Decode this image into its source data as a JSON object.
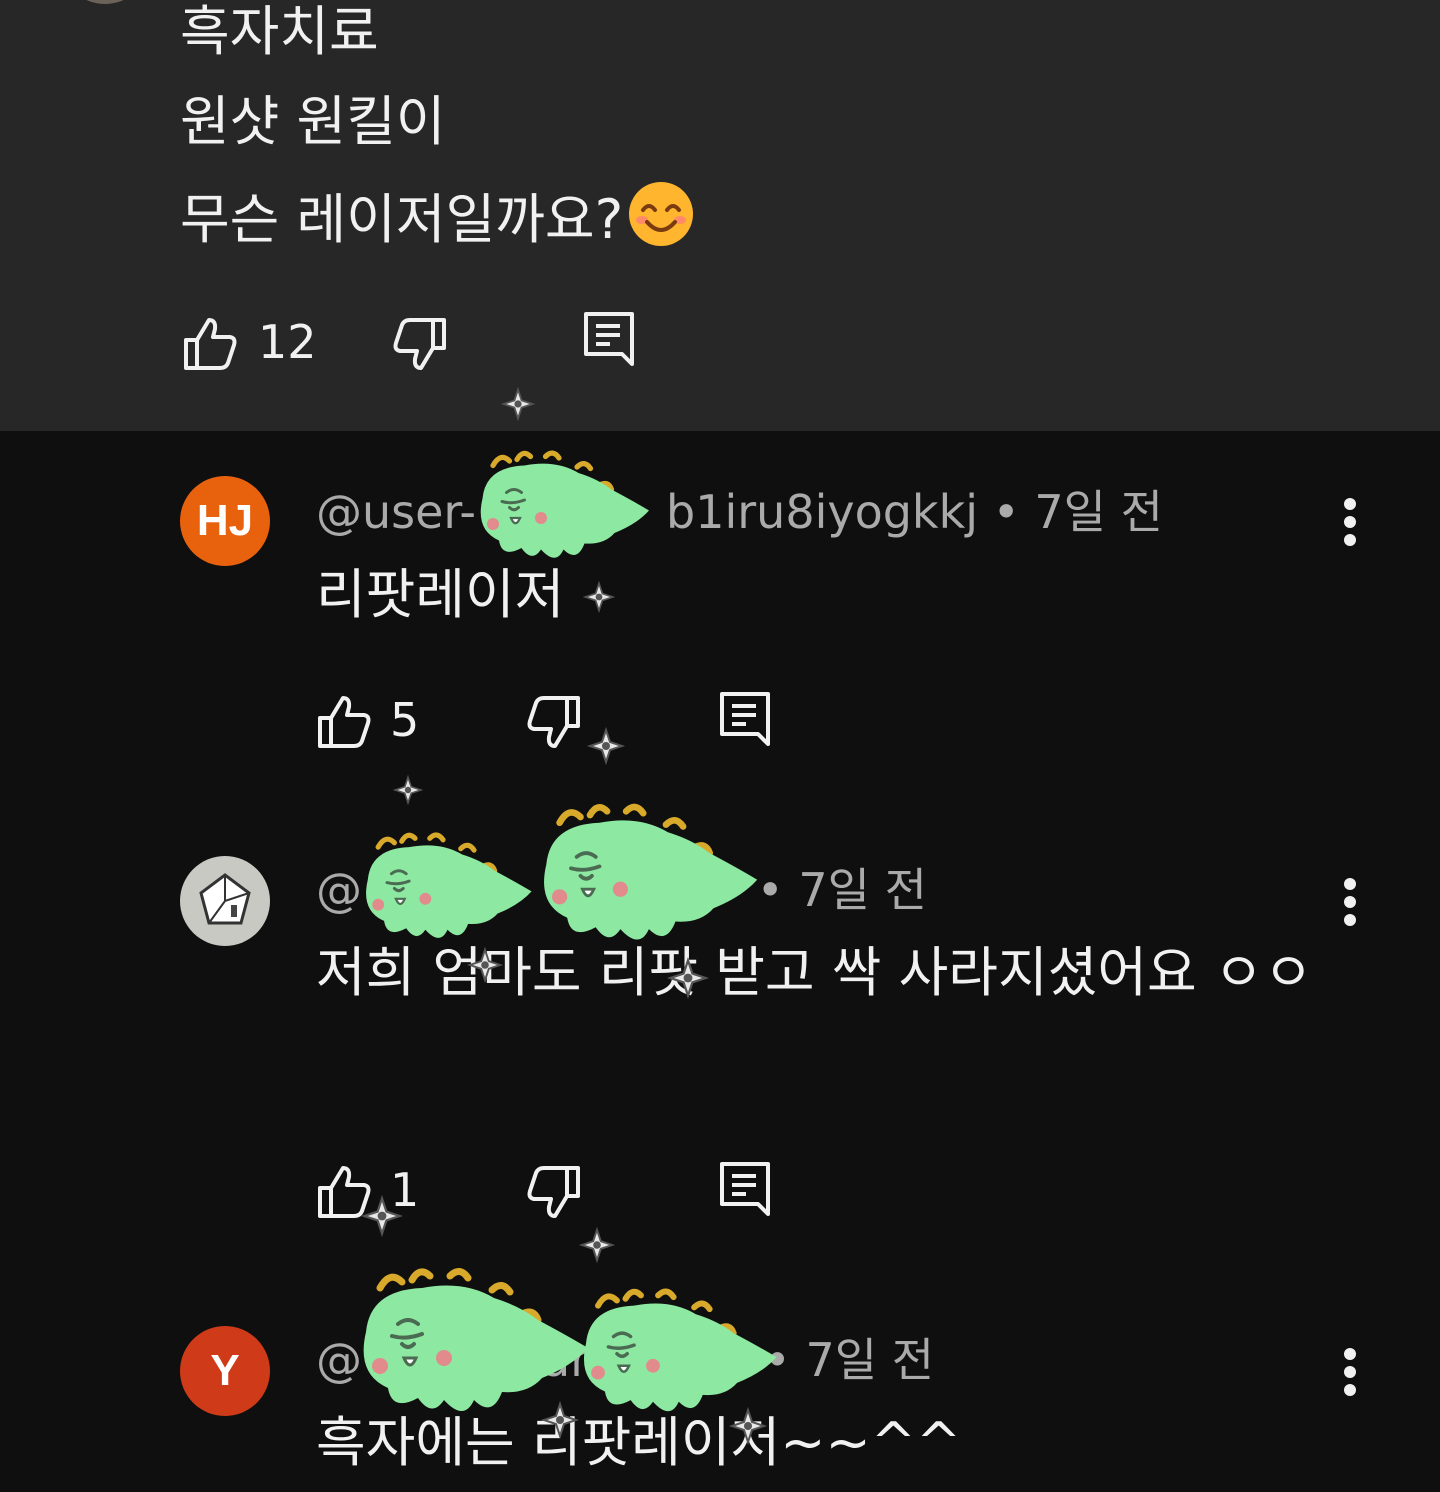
{
  "parent_comment": {
    "lines": [
      "흑자치료",
      "원샷 원킬이",
      "무슨 레이저일까요?"
    ],
    "emoji": "smiling-face-icon",
    "like_count": "12"
  },
  "replies": [
    {
      "avatar_initials": "HJ",
      "avatar_color": "#e8620e",
      "handle": "@user-",
      "handle_tail": "b1iru8iyogkkj",
      "separator": "•",
      "time": "7일 전",
      "text": "리팟레이저",
      "like_count": "5"
    },
    {
      "avatar_initials": "",
      "avatar_color": "#c9c9c4",
      "handle": "@",
      "separator": "•",
      "time": "7일 전",
      "text": "저희 엄마도 리팟 받고 싹 사라지셨어요 ㅇㅇ",
      "like_count": "1"
    },
    {
      "avatar_initials": "Y",
      "avatar_color": "#cf3a18",
      "handle": "@",
      "handle_mid": "ar",
      "separator": "•",
      "time": "7일 전",
      "text": "흑자에는 리팟레이저~~^^"
    }
  ],
  "icons": {
    "like": "thumbs-up-icon",
    "dislike": "thumbs-down-icon",
    "reply": "reply-comment-icon",
    "more": "more-vertical-icon"
  },
  "colors": {
    "background": "#0f0f0f",
    "highlight_background": "#272727",
    "text_primary": "#f1f1f1",
    "text_secondary": "#aaaaaa",
    "sticker_green": "#8de8a1"
  }
}
